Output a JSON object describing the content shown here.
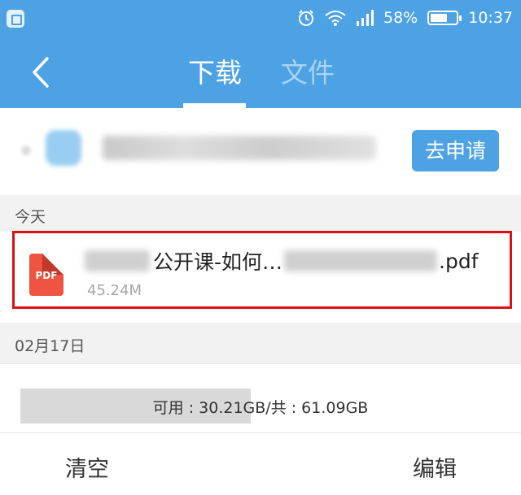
{
  "status_bar": {
    "battery": "58%",
    "battery_level": 0.58,
    "time": "10:37",
    "icons": [
      "notification-icon",
      "alarm-icon",
      "wifi-icon",
      "signal-icon",
      "battery-icon"
    ]
  },
  "header": {
    "tabs": [
      {
        "label": "下载",
        "active": true
      },
      {
        "label": "文件",
        "active": false
      }
    ],
    "back_icon": "chevron-left-icon"
  },
  "apply_row": {
    "button_label": "去申请"
  },
  "sections": {
    "today_label": "今天",
    "date_label": "02月17日"
  },
  "file": {
    "name_visible": "公开课-如何…",
    "name_suffix": ".pdf",
    "size": "45.24M",
    "icon_label": "PDF"
  },
  "storage": {
    "text": "可用 : 30.21GB/共 : 61.09GB",
    "used_fraction": 0.48
  },
  "bottom_bar": {
    "clear_label": "清空",
    "edit_label": "编辑"
  },
  "colors": {
    "primary": "#4da2e3",
    "highlight_border": "#dd1111",
    "pdf_icon": "#ef5341"
  }
}
